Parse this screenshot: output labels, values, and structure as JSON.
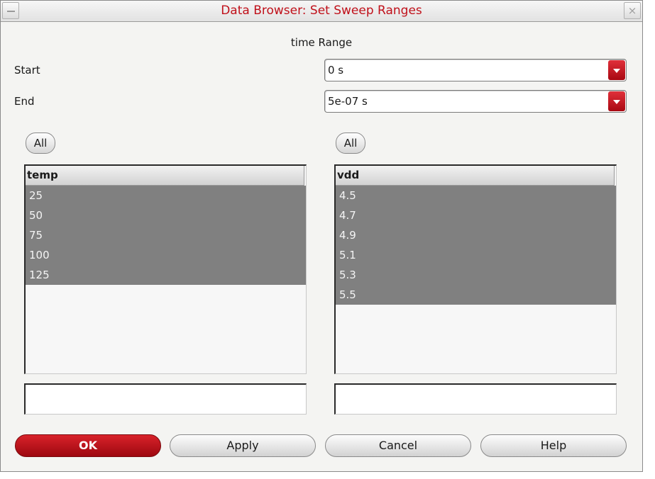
{
  "window": {
    "title": "Data Browser: Set Sweep Ranges",
    "close_glyph": "⨯"
  },
  "time_range": {
    "title": "time Range",
    "start": {
      "label": "Start",
      "value": "0 s"
    },
    "end": {
      "label": "End",
      "value": "5e-07 s"
    }
  },
  "sweeps": [
    {
      "all_label": "All",
      "header": "temp",
      "values": [
        "25",
        "50",
        "75",
        "100",
        "125"
      ],
      "filter_value": ""
    },
    {
      "all_label": "All",
      "header": "vdd",
      "values": [
        "4.5",
        "4.7",
        "4.9",
        "5.1",
        "5.3",
        "5.5"
      ],
      "filter_value": ""
    }
  ],
  "buttons": {
    "ok": "OK",
    "apply": "Apply",
    "cancel": "Cancel",
    "help": "Help"
  },
  "colors": {
    "title": "#c0101a",
    "accent": "#c0101a",
    "selection": "#808080"
  }
}
